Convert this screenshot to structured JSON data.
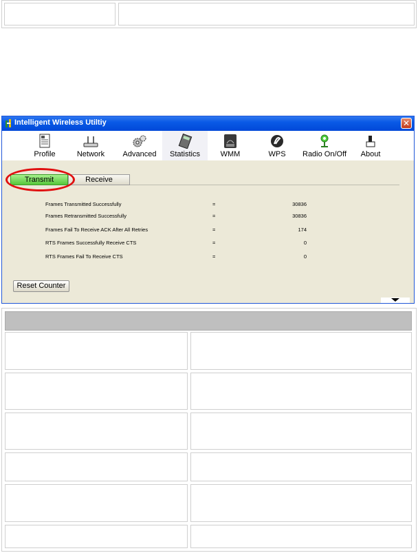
{
  "window": {
    "title": "Intelligent Wireless Utiltiy",
    "close_glyph": "✕"
  },
  "toolbar": {
    "items": [
      {
        "label": "Profile",
        "icon": "profile-icon"
      },
      {
        "label": "Network",
        "icon": "network-icon"
      },
      {
        "label": "Advanced",
        "icon": "advanced-icon"
      },
      {
        "label": "Statistics",
        "icon": "statistics-icon"
      },
      {
        "label": "WMM",
        "icon": "wmm-icon"
      },
      {
        "label": "WPS",
        "icon": "wps-icon"
      },
      {
        "label": "Radio On/Off",
        "icon": "radio-icon"
      },
      {
        "label": "About",
        "icon": "about-icon"
      }
    ],
    "active": "Statistics"
  },
  "tabs": {
    "transmit": "Transmit",
    "receive": "Receive",
    "selected": "Transmit"
  },
  "stats": [
    {
      "label": "Frames Transmitted Successfully",
      "eq": "=",
      "value": "30836"
    },
    {
      "label": "Frames Retransmitted Successfully",
      "eq": "=",
      "value": "30836"
    },
    {
      "label": "Frames Fail To Receive ACK After All Retries",
      "eq": "=",
      "value": "174"
    },
    {
      "label": "RTS Frames Successfully Receive CTS",
      "eq": "=",
      "value": "0"
    },
    {
      "label": "RTS Frames Fail To Receive CTS",
      "eq": "=",
      "value": "0"
    }
  ],
  "buttons": {
    "reset_counter": "Reset Counter"
  },
  "colors": {
    "titlebar": "#0a5ae6",
    "transmit_tab": "#55c73a",
    "highlight_oval": "#e01010",
    "window_bg": "#ece9d8"
  }
}
